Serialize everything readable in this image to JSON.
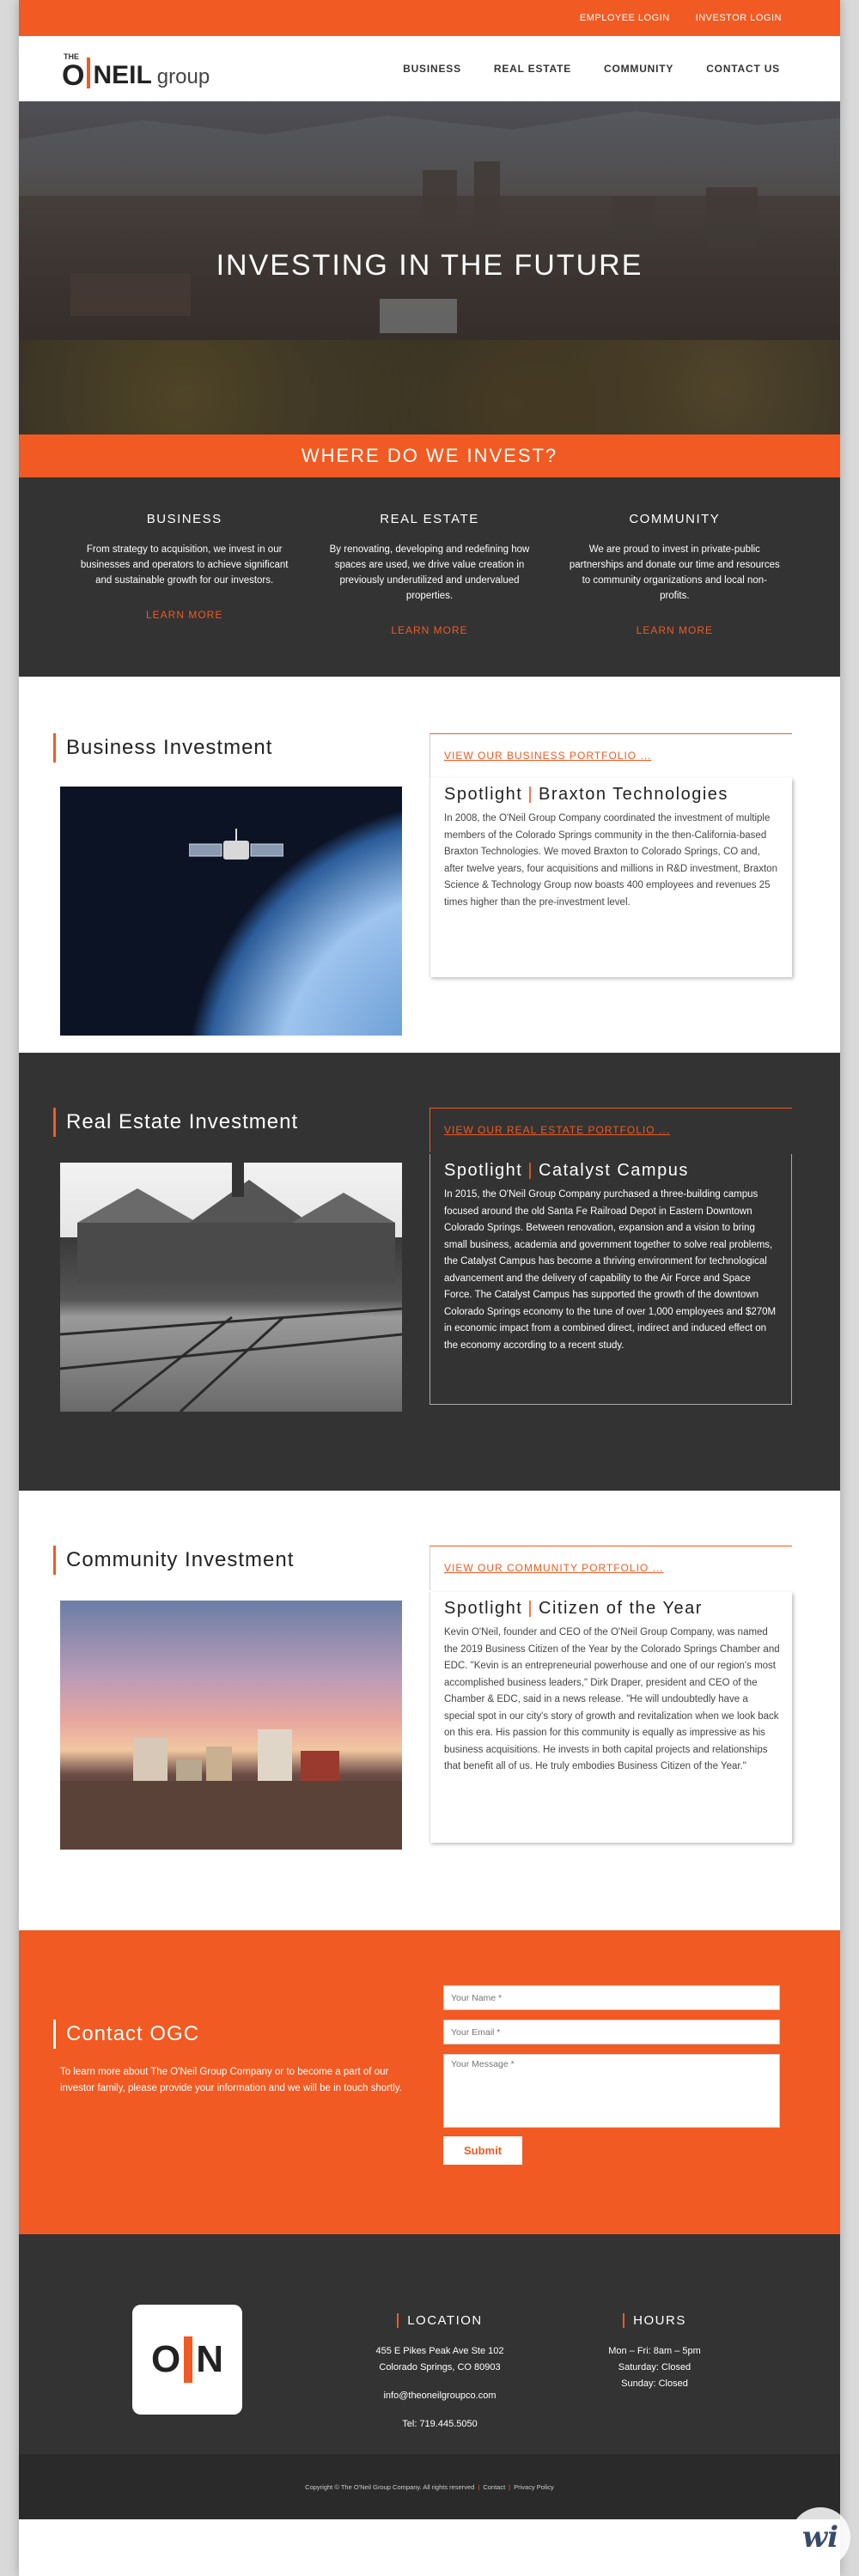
{
  "topbar": {
    "employee_login": "EMPLOYEE LOGIN",
    "investor_login": "INVESTOR LOGIN"
  },
  "logo": {
    "the": "THE",
    "o": "O",
    "neil": "NEIL",
    "group": "group"
  },
  "nav": {
    "items": [
      "BUSINESS",
      "REAL ESTATE",
      "COMMUNITY",
      "CONTACT US"
    ]
  },
  "hero": {
    "title": "INVESTING IN THE FUTURE"
  },
  "invest_band": {
    "title": "WHERE DO WE INVEST?"
  },
  "columns": [
    {
      "title": "BUSINESS",
      "text": "From strategy to acquisition, we invest in our businesses and operators to achieve significant and sustainable growth for our investors.",
      "link": "LEARN MORE"
    },
    {
      "title": "REAL ESTATE",
      "text": "By renovating, developing and redefining how spaces are used, we drive value creation in previously underutilized and undervalued properties.",
      "link": "LEARN MORE"
    },
    {
      "title": "COMMUNITY",
      "text": "We are proud to invest in private-public partnerships and donate our time and resources to community organizations and local non-profits.",
      "link": "LEARN MORE"
    }
  ],
  "business": {
    "title": "Business Investment",
    "portfolio_link": "VIEW OUR BUSINESS PORTFOLIO ...",
    "spotlight": "Spotlight",
    "name": "Braxton Technologies",
    "text": "In 2008, the O'Neil Group Company coordinated the investment of multiple members of the Colorado Springs community in the then-California-based Braxton Technologies. We moved Braxton to Colorado Springs, CO and, after twelve years, four acquisitions and millions in R&D investment, Braxton Science & Technology Group now boasts 400 employees and revenues 25 times higher than the pre-investment level."
  },
  "real_estate": {
    "title": "Real Estate Investment",
    "portfolio_link": "VIEW OUR REAL ESTATE PORTFOLIO ...",
    "spotlight": "Spotlight",
    "name": "Catalyst Campus",
    "text": "In 2015, the O'Neil Group Company purchased a three-building campus focused around the old Santa Fe Railroad Depot in Eastern Downtown Colorado Springs. Between renovation, expansion and a vision to bring small business, academia and government together to solve real problems, the Catalyst Campus has become a thriving environment for technological advancement and the delivery of capability to the Air Force and Space Force. The Catalyst Campus has supported the growth of the downtown Colorado Springs economy to the tune of over 1,000 employees and $270M in economic impact from a combined direct, indirect and induced effect on the economy according to a recent study."
  },
  "community": {
    "title": "Community Investment",
    "portfolio_link": "VIEW OUR COMMUNITY PORTFOLIO ...",
    "spotlight": "Spotlight",
    "name": "Citizen of the Year",
    "text": "Kevin O'Neil, founder and CEO of the O'Neil Group Company, was named the 2019 Business Citizen of the Year by the Colorado Springs Chamber and EDC. \"Kevin is an entrepreneurial powerhouse and one of our region's most accomplished business leaders,\" Dirk Draper, president and CEO of the Chamber & EDC, said in a news release. \"He will undoubtedly have a special spot in our city's story of growth and revitalization when we look back on this era. His passion for this community is equally as impressive as his business acquisitions. He invests in both capital projects and relationships that benefit all of us. He truly embodies Business Citizen of the Year.\""
  },
  "contact": {
    "title": "Contact OGC",
    "intro": "To learn more about The O'Neil Group Company or to become a part of our investor family, please provide your information and we will be in touch shortly.",
    "name_placeholder": "Your Name *",
    "email_placeholder": "Your Email *",
    "message_placeholder": "Your Message *",
    "submit": "Submit"
  },
  "footer": {
    "logo_o": "O",
    "logo_n": "N",
    "location_title": "LOCATION",
    "address1": "455 E Pikes Peak Ave Ste 102",
    "address2": "Colorado Springs, CO 80903",
    "email": "info@theoneilgroupco.com",
    "phone": "Tel: 719.445.5050",
    "hours_title": "HOURS",
    "hours1": "Mon – Fri: 8am – 5pm",
    "hours2": "Saturday: Closed",
    "hours3": "Sunday: Closed",
    "copyright": "Copyright © The O'Neil Group Company. All rights reserved",
    "contact_link": "Contact",
    "privacy_link": "Privacy Policy",
    "badge": "wi"
  },
  "colors": {
    "accent": "#f15a22",
    "dark": "#333333"
  }
}
